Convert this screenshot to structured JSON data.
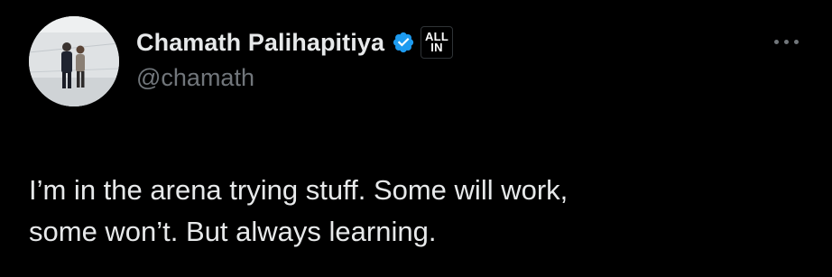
{
  "author": {
    "display_name": "Chamath Palihapitiya",
    "handle": "@chamath",
    "verified": true,
    "affiliate_badge": {
      "line1": "ALL",
      "line2": "IN"
    },
    "avatar_icon": "profile-photo-two-people"
  },
  "tweet": {
    "lines": [
      "I’m in the arena trying stuff. Some will work,",
      "some won’t. But always learning."
    ]
  },
  "menu": {
    "icon": "more-horizontal-icon"
  },
  "colors": {
    "background": "#000000",
    "primary_text": "#e7e9ea",
    "secondary_text": "#71767b",
    "verified_blue": "#1d9bf0"
  }
}
